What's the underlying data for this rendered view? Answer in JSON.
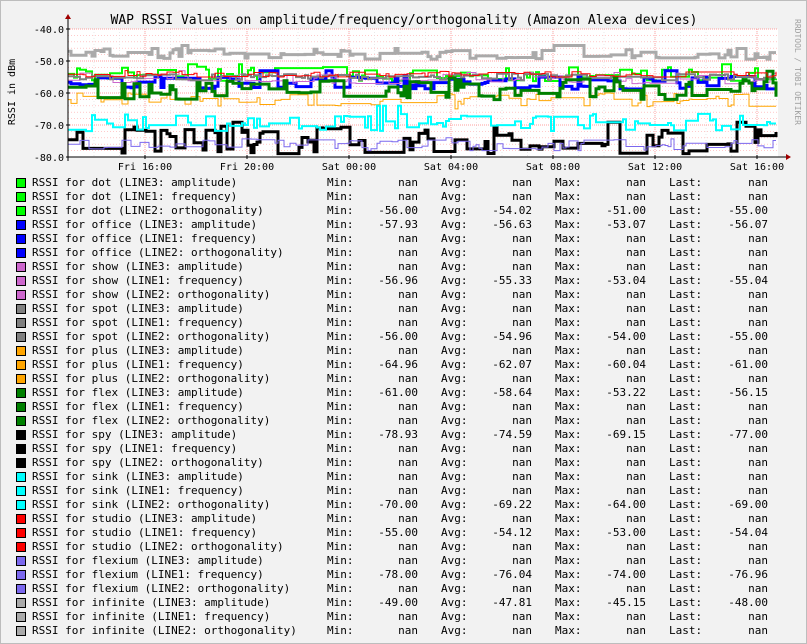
{
  "chart_data": {
    "type": "line",
    "title": "WAP RSSI Values on amplitude/frequency/orthogonality (Amazon Alexa devices)",
    "ylabel": "RSSI in dBm",
    "watermark": "RRDTOOL / TOBI OETIKER",
    "ylim": [
      -80.0,
      -40.0
    ],
    "y_ticks": [
      "-40.0",
      "-50.0",
      "-60.0",
      "-70.0",
      "-80.0"
    ],
    "x_ticks": [
      "Fri 16:00",
      "Fri 20:00",
      "Sat 00:00",
      "Sat 04:00",
      "Sat 08:00",
      "Sat 12:00",
      "Sat 16:00"
    ],
    "grid": true,
    "legend_placement": "bottom",
    "series": [
      {
        "name": "RSSI for dot (LINE3: amplitude)",
        "color": "#00ff00",
        "min": "nan",
        "avg": "nan",
        "max": "nan",
        "last": "nan"
      },
      {
        "name": "RSSI for dot (LINE1: frequency)",
        "color": "#00ff00",
        "min": "nan",
        "avg": "nan",
        "max": "nan",
        "last": "nan"
      },
      {
        "name": "RSSI for dot (LINE2: orthogonality)",
        "color": "#00ff00",
        "min": "-56.00",
        "avg": "-54.02",
        "max": "-51.00",
        "last": "-55.00"
      },
      {
        "name": "RSSI for office (LINE3: amplitude)",
        "color": "#0000ff",
        "min": "-57.93",
        "avg": "-56.63",
        "max": "-53.07",
        "last": "-56.07"
      },
      {
        "name": "RSSI for office (LINE1: frequency)",
        "color": "#0000ff",
        "min": "nan",
        "avg": "nan",
        "max": "nan",
        "last": "nan"
      },
      {
        "name": "RSSI for office (LINE2: orthogonality)",
        "color": "#0000ff",
        "min": "nan",
        "avg": "nan",
        "max": "nan",
        "last": "nan"
      },
      {
        "name": "RSSI for show (LINE3: amplitude)",
        "color": "#cc66cc",
        "min": "nan",
        "avg": "nan",
        "max": "nan",
        "last": "nan"
      },
      {
        "name": "RSSI for show (LINE1: frequency)",
        "color": "#cc66cc",
        "min": "-56.96",
        "avg": "-55.33",
        "max": "-53.04",
        "last": "-55.04"
      },
      {
        "name": "RSSI for show (LINE2: orthogonality)",
        "color": "#cc66cc",
        "min": "nan",
        "avg": "nan",
        "max": "nan",
        "last": "nan"
      },
      {
        "name": "RSSI for spot (LINE3: amplitude)",
        "color": "#808080",
        "min": "nan",
        "avg": "nan",
        "max": "nan",
        "last": "nan"
      },
      {
        "name": "RSSI for spot (LINE1: frequency)",
        "color": "#808080",
        "min": "nan",
        "avg": "nan",
        "max": "nan",
        "last": "nan"
      },
      {
        "name": "RSSI for spot (LINE2: orthogonality)",
        "color": "#808080",
        "min": "-56.00",
        "avg": "-54.96",
        "max": "-54.00",
        "last": "-55.00"
      },
      {
        "name": "RSSI for plus (LINE3: amplitude)",
        "color": "#ffa500",
        "min": "nan",
        "avg": "nan",
        "max": "nan",
        "last": "nan"
      },
      {
        "name": "RSSI for plus (LINE1: frequency)",
        "color": "#ffa500",
        "min": "-64.96",
        "avg": "-62.07",
        "max": "-60.04",
        "last": "-61.00"
      },
      {
        "name": "RSSI for plus (LINE2: orthogonality)",
        "color": "#ffa500",
        "min": "nan",
        "avg": "nan",
        "max": "nan",
        "last": "nan"
      },
      {
        "name": "RSSI for flex (LINE3: amplitude)",
        "color": "#008000",
        "min": "-61.00",
        "avg": "-58.64",
        "max": "-53.22",
        "last": "-56.15"
      },
      {
        "name": "RSSI for flex (LINE1: frequency)",
        "color": "#008000",
        "min": "nan",
        "avg": "nan",
        "max": "nan",
        "last": "nan"
      },
      {
        "name": "RSSI for flex (LINE2: orthogonality)",
        "color": "#008000",
        "min": "nan",
        "avg": "nan",
        "max": "nan",
        "last": "nan"
      },
      {
        "name": "RSSI for spy (LINE3: amplitude)",
        "color": "#000000",
        "min": "-78.93",
        "avg": "-74.59",
        "max": "-69.15",
        "last": "-77.00"
      },
      {
        "name": "RSSI for spy (LINE1: frequency)",
        "color": "#000000",
        "min": "nan",
        "avg": "nan",
        "max": "nan",
        "last": "nan"
      },
      {
        "name": "RSSI for spy (LINE2: orthogonality)",
        "color": "#000000",
        "min": "nan",
        "avg": "nan",
        "max": "nan",
        "last": "nan"
      },
      {
        "name": "RSSI for sink (LINE3: amplitude)",
        "color": "#00ffff",
        "min": "nan",
        "avg": "nan",
        "max": "nan",
        "last": "nan"
      },
      {
        "name": "RSSI for sink (LINE1: frequency)",
        "color": "#00ffff",
        "min": "nan",
        "avg": "nan",
        "max": "nan",
        "last": "nan"
      },
      {
        "name": "RSSI for sink (LINE2: orthogonality)",
        "color": "#00ffff",
        "min": "-70.00",
        "avg": "-69.22",
        "max": "-64.00",
        "last": "-69.00"
      },
      {
        "name": "RSSI for studio (LINE3: amplitude)",
        "color": "#ff0000",
        "min": "nan",
        "avg": "nan",
        "max": "nan",
        "last": "nan"
      },
      {
        "name": "RSSI for studio (LINE1: frequency)",
        "color": "#ff0000",
        "min": "-55.00",
        "avg": "-54.12",
        "max": "-53.00",
        "last": "-54.04"
      },
      {
        "name": "RSSI for studio (LINE2: orthogonality)",
        "color": "#ff0000",
        "min": "nan",
        "avg": "nan",
        "max": "nan",
        "last": "nan"
      },
      {
        "name": "RSSI for flexium (LINE3: amplitude)",
        "color": "#7b68ee",
        "min": "nan",
        "avg": "nan",
        "max": "nan",
        "last": "nan"
      },
      {
        "name": "RSSI for flexium (LINE1: frequency)",
        "color": "#7b68ee",
        "min": "-78.00",
        "avg": "-76.04",
        "max": "-74.00",
        "last": "-76.96"
      },
      {
        "name": "RSSI for flexium (LINE2: orthogonality)",
        "color": "#7b68ee",
        "min": "nan",
        "avg": "nan",
        "max": "nan",
        "last": "nan"
      },
      {
        "name": "RSSI for infinite (LINE3: amplitude)",
        "color": "#aaaaaa",
        "min": "-49.00",
        "avg": "-47.81",
        "max": "-45.15",
        "last": "-48.00"
      },
      {
        "name": "RSSI for infinite (LINE1: frequency)",
        "color": "#aaaaaa",
        "min": "nan",
        "avg": "nan",
        "max": "nan",
        "last": "nan"
      },
      {
        "name": "RSSI for infinite (LINE2: orthogonality)",
        "color": "#aaaaaa",
        "min": "nan",
        "avg": "nan",
        "max": "nan",
        "last": "nan"
      }
    ]
  },
  "legend_labels": {
    "min": "Min:",
    "avg": "Avg:",
    "max": "Max:",
    "last": "Last:"
  }
}
